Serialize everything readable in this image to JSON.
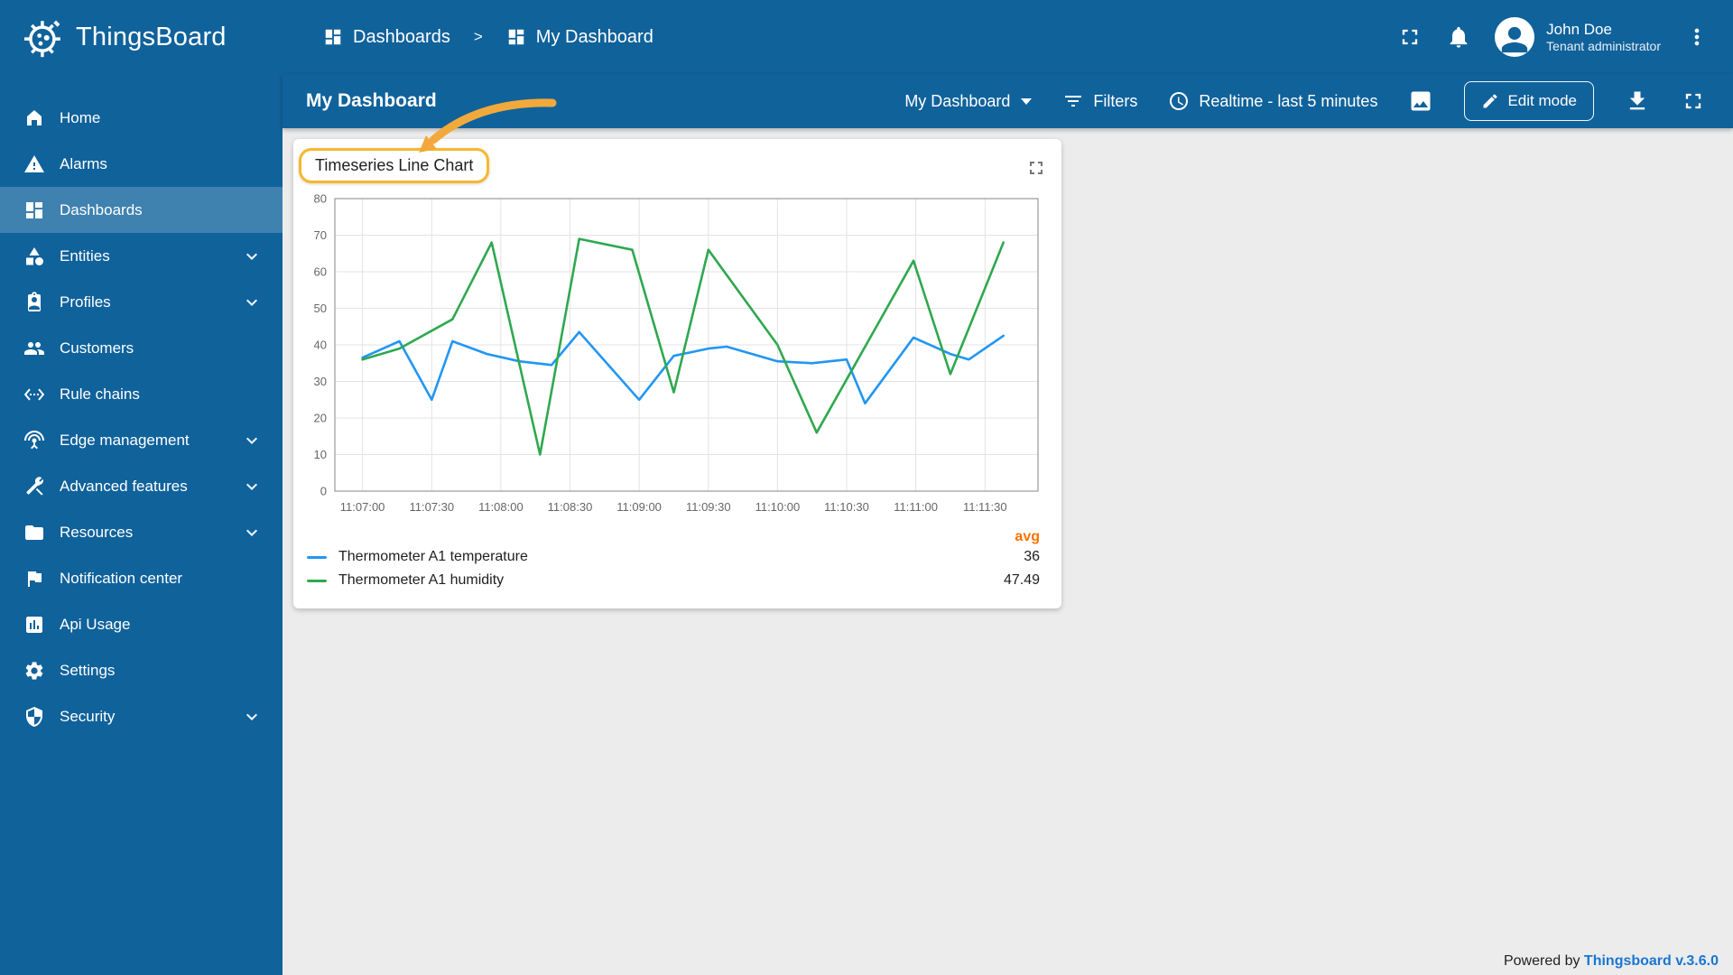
{
  "colors": {
    "primary": "#10629b",
    "sidebar_selected": "rgba(255,255,255,0.2)",
    "avg_header": "#ff7200",
    "temperature_line": "#2196f3",
    "humidity_line": "#2fa84f",
    "annotation": "#f2a93b",
    "link": "#1976d2"
  },
  "app": {
    "name": "ThingsBoard"
  },
  "sidebar": {
    "items": [
      {
        "label": "Home",
        "icon": "home-icon",
        "expandable": false,
        "active": false
      },
      {
        "label": "Alarms",
        "icon": "warning-icon",
        "expandable": false,
        "active": false
      },
      {
        "label": "Dashboards",
        "icon": "dashboards-icon",
        "expandable": false,
        "active": true
      },
      {
        "label": "Entities",
        "icon": "entities-icon",
        "expandable": true,
        "active": false
      },
      {
        "label": "Profiles",
        "icon": "profiles-icon",
        "expandable": true,
        "active": false
      },
      {
        "label": "Customers",
        "icon": "customers-icon",
        "expandable": false,
        "active": false
      },
      {
        "label": "Rule chains",
        "icon": "rule-chains-icon",
        "expandable": false,
        "active": false
      },
      {
        "label": "Edge management",
        "icon": "edge-management-icon",
        "expandable": true,
        "active": false
      },
      {
        "label": "Advanced features",
        "icon": "advanced-features-icon",
        "expandable": true,
        "active": false
      },
      {
        "label": "Resources",
        "icon": "resources-icon",
        "expandable": true,
        "active": false
      },
      {
        "label": "Notification center",
        "icon": "notification-center-icon",
        "expandable": false,
        "active": false
      },
      {
        "label": "Api Usage",
        "icon": "api-usage-icon",
        "expandable": false,
        "active": false
      },
      {
        "label": "Settings",
        "icon": "settings-icon",
        "expandable": false,
        "active": false
      },
      {
        "label": "Security",
        "icon": "security-icon",
        "expandable": true,
        "active": false
      }
    ]
  },
  "header": {
    "breadcrumb": {
      "separator": ">",
      "items": [
        {
          "label": "Dashboards",
          "icon": "dashboards-icon"
        },
        {
          "label": "My Dashboard",
          "icon": "dashboards-icon"
        }
      ]
    },
    "user": {
      "name": "John Doe",
      "role": "Tenant administrator"
    }
  },
  "toolbar": {
    "title": "My Dashboard",
    "state_select": "My Dashboard",
    "filters_label": "Filters",
    "time_label": "Realtime - last 5 minutes",
    "edit_label": "Edit mode"
  },
  "widget": {
    "title": "Timeseries Line Chart",
    "legend": {
      "avg_label": "avg",
      "items": [
        {
          "name": "Thermometer A1 temperature",
          "color": "#2196f3",
          "avg": "36"
        },
        {
          "name": "Thermometer A1 humidity",
          "color": "#2fa84f",
          "avg": "47.49"
        }
      ]
    }
  },
  "chart_data": {
    "type": "line",
    "title": "Timeseries Line Chart",
    "x_axis_type": "time",
    "grid": true,
    "legend_position": "bottom",
    "ylim": [
      0,
      80
    ],
    "yticks": [
      0,
      10,
      20,
      30,
      40,
      50,
      60,
      70,
      80
    ],
    "x_range_seconds": [
      -12,
      293
    ],
    "xticks": [
      {
        "t": 0,
        "label": "11:07:00"
      },
      {
        "t": 30,
        "label": "11:07:30"
      },
      {
        "t": 60,
        "label": "11:08:00"
      },
      {
        "t": 90,
        "label": "11:08:30"
      },
      {
        "t": 120,
        "label": "11:09:00"
      },
      {
        "t": 150,
        "label": "11:09:30"
      },
      {
        "t": 180,
        "label": "11:10:00"
      },
      {
        "t": 210,
        "label": "11:10:30"
      },
      {
        "t": 240,
        "label": "11:11:00"
      },
      {
        "t": 270,
        "label": "11:11:30"
      }
    ],
    "series": [
      {
        "name": "Thermometer A1 temperature",
        "color": "#2196f3",
        "avg": 36,
        "points": [
          [
            0,
            36.5
          ],
          [
            16,
            41
          ],
          [
            30,
            25
          ],
          [
            39,
            41
          ],
          [
            54,
            37.5
          ],
          [
            68,
            35.5
          ],
          [
            82,
            34.5
          ],
          [
            94,
            43.5
          ],
          [
            120,
            25
          ],
          [
            135,
            37
          ],
          [
            150,
            39
          ],
          [
            158,
            39.5
          ],
          [
            180,
            35.5
          ],
          [
            195,
            35
          ],
          [
            210,
            36
          ],
          [
            218,
            24
          ],
          [
            239,
            42
          ],
          [
            255,
            37.5
          ],
          [
            263,
            36
          ],
          [
            278,
            42.5
          ]
        ]
      },
      {
        "name": "Thermometer A1 humidity",
        "color": "#2fa84f",
        "avg": 47.49,
        "points": [
          [
            0,
            36
          ],
          [
            16,
            39
          ],
          [
            39,
            47
          ],
          [
            56,
            68
          ],
          [
            77,
            10
          ],
          [
            94,
            69
          ],
          [
            117,
            66
          ],
          [
            135,
            27
          ],
          [
            150,
            66
          ],
          [
            180,
            40
          ],
          [
            197,
            16
          ],
          [
            239,
            63
          ],
          [
            255,
            32
          ],
          [
            278,
            68
          ]
        ]
      }
    ]
  },
  "footer": {
    "prefix": "Powered by",
    "link": "Thingsboard v.3.6.0"
  }
}
